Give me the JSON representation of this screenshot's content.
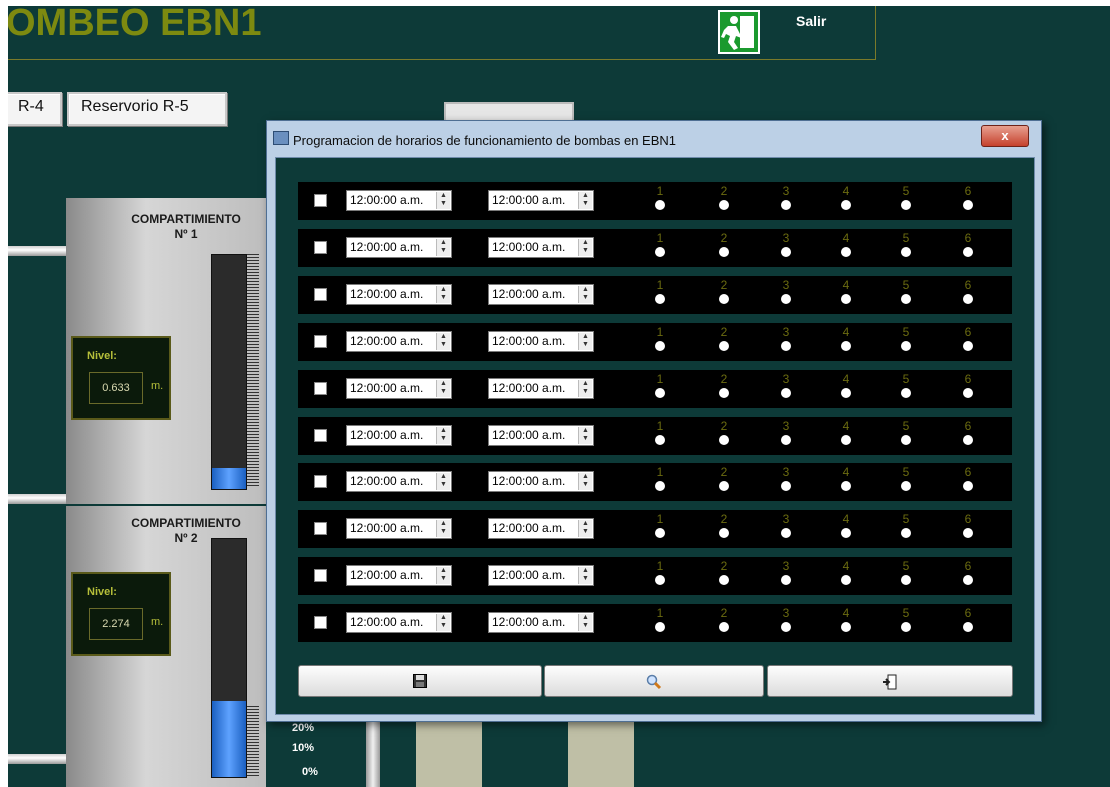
{
  "app": {
    "title": "OMBEO EBN1",
    "exit_label": "Salir",
    "tabs": [
      {
        "label": "R-4"
      },
      {
        "label": "Reservorio R-5"
      }
    ]
  },
  "tanks": [
    {
      "title": "COMPARTIMIENTO",
      "subtitle": "Nº 1",
      "level_label": "Nivel:",
      "level_value": "0.633",
      "level_unit": "m.",
      "fill_fraction": 0.09
    },
    {
      "title": "COMPARTIMIENTO",
      "subtitle": "Nº 2",
      "level_label": "Nivel:",
      "level_value": "2.274",
      "level_unit": "m.",
      "fill_fraction": 0.32
    }
  ],
  "scale_labels": [
    "20%",
    "10%",
    "0%"
  ],
  "dialog": {
    "title": "Programacion de horarios de funcionamiento de bombas en EBN1",
    "close_label": "x",
    "pump_numbers": [
      "1",
      "2",
      "3",
      "4",
      "5",
      "6"
    ],
    "rows": [
      {
        "start": "12:00:00 a.m.",
        "end": "12:00:00 a.m."
      },
      {
        "start": "12:00:00 a.m.",
        "end": "12:00:00 a.m."
      },
      {
        "start": "12:00:00 a.m.",
        "end": "12:00:00 a.m."
      },
      {
        "start": "12:00:00 a.m.",
        "end": "12:00:00 a.m."
      },
      {
        "start": "12:00:00 a.m.",
        "end": "12:00:00 a.m."
      },
      {
        "start": "12:00:00 a.m.",
        "end": "12:00:00 a.m."
      },
      {
        "start": "12:00:00 a.m.",
        "end": "12:00:00 a.m."
      },
      {
        "start": "12:00:00 a.m.",
        "end": "12:00:00 a.m."
      },
      {
        "start": "12:00:00 a.m.",
        "end": "12:00:00 a.m."
      },
      {
        "start": "12:00:00 a.m.",
        "end": "12:00:00 a.m."
      }
    ],
    "buttons": [
      {
        "icon": "floppy-disk-icon"
      },
      {
        "icon": "magnifier-icon"
      },
      {
        "icon": "exit-door-icon"
      }
    ]
  },
  "colors": {
    "background": "#0d3a38",
    "title_olive": "#7d8a10",
    "pump_number": "#6b6b10",
    "gauge_blue": "#3a7fdf"
  }
}
